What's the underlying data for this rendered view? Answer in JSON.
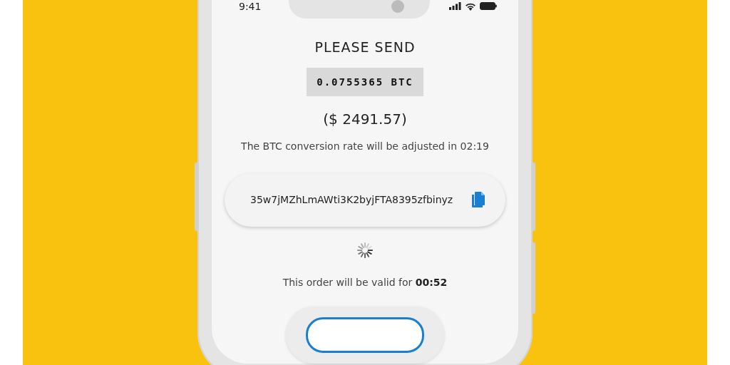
{
  "status_bar": {
    "time": "9:41"
  },
  "heading": "PLEASE SEND",
  "amount": "0.0755365 BTC",
  "fiat_amount": "($ 2491.57)",
  "rate_note": "The BTC conversion rate will be adjusted in 02:19",
  "address": "35w7jMZhLmAWti3K2byjFTA8395zfbinyz",
  "validity": "This order will be valid for **00:52**"
}
